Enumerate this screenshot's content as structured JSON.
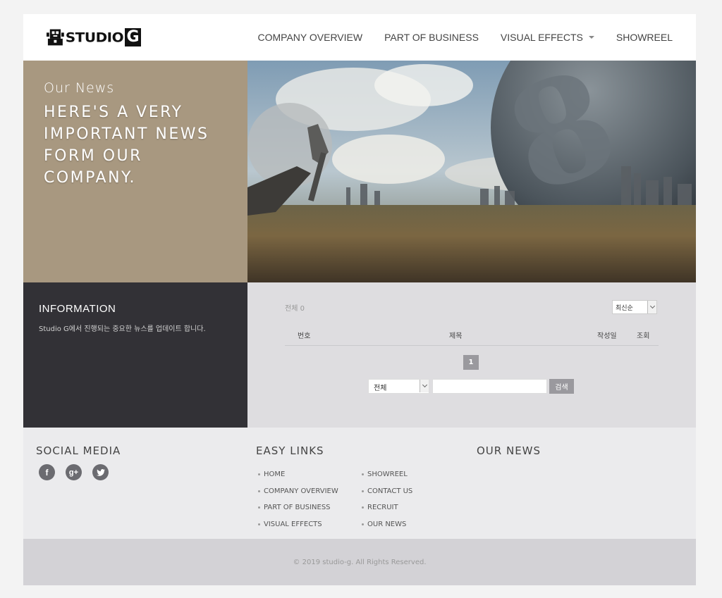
{
  "header": {
    "logo_text": "STUDIO",
    "logo_g": "G",
    "nav": [
      {
        "label": "COMPANY OVERVIEW"
      },
      {
        "label": "PART OF BUSINESS"
      },
      {
        "label": "VISUAL EFFECTS"
      },
      {
        "label": "SHOWREEL"
      }
    ]
  },
  "hero": {
    "subtitle": "Our News",
    "title": "HERE'S A VERY IMPORTANT NEWS FORM OUR COMPANY."
  },
  "info": {
    "title": "INFORMATION",
    "description": "Studio G에서 진행되는 중요한 뉴스를 업데이트 합니다."
  },
  "board": {
    "total": "전체 0",
    "sort_selected": "최신순",
    "columns": [
      "번호",
      "제목",
      "작성일",
      "조회"
    ],
    "page": "1",
    "search_scope": "전체",
    "search_button": "검색"
  },
  "footer": {
    "social_title": "SOCIAL MEDIA",
    "links_title": "EASY LINKS",
    "news_title": "OUR NEWS",
    "links_col1": [
      "HOME",
      "COMPANY OVERVIEW",
      "PART OF BUSINESS",
      "VISUAL EFFECTS"
    ],
    "links_col2": [
      "SHOWREEL",
      "CONTACT US",
      "RECRUIT",
      "OUR NEWS"
    ],
    "copyright": "© 2019 studio-g. All Rights Reserved."
  },
  "icons": {
    "facebook": "facebook-icon",
    "google_plus": "google-plus-icon",
    "twitter": "twitter-icon"
  }
}
